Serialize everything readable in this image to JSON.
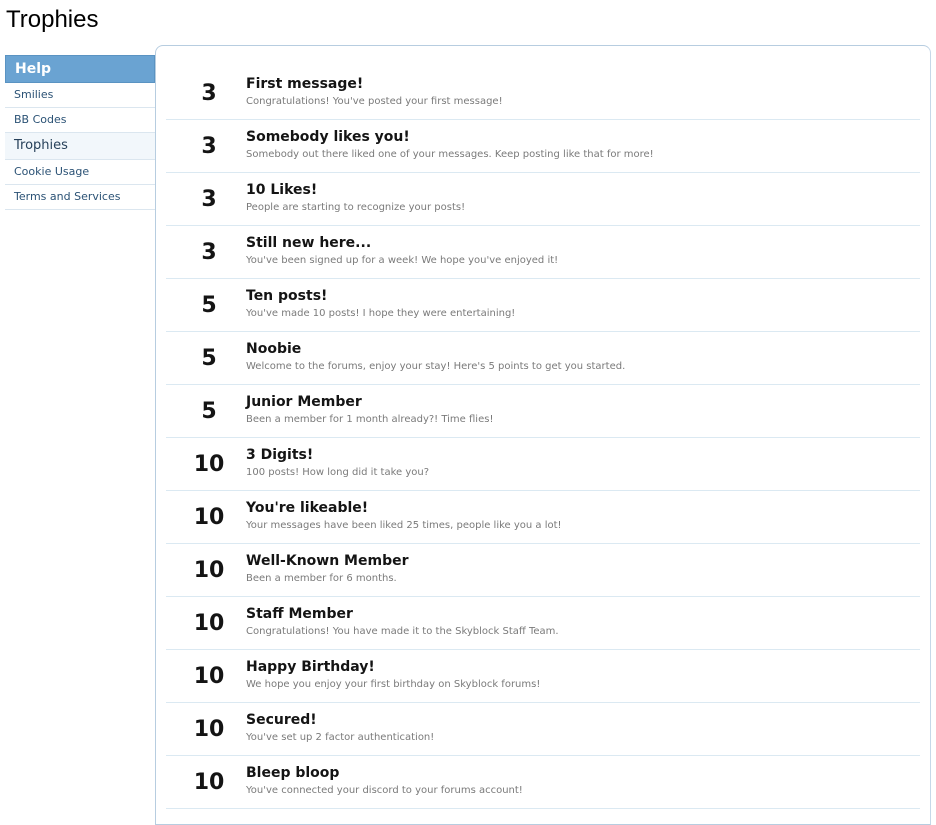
{
  "page": {
    "title": "Trophies"
  },
  "sidebar": {
    "header": "Help",
    "items": [
      {
        "label": "Smilies",
        "active": false
      },
      {
        "label": "BB Codes",
        "active": false
      },
      {
        "label": "Trophies",
        "active": true
      },
      {
        "label": "Cookie Usage",
        "active": false
      },
      {
        "label": "Terms and Services",
        "active": false
      }
    ]
  },
  "trophies": [
    {
      "points": "3",
      "title": "First message!",
      "description": "Congratulations! You've posted your first message!"
    },
    {
      "points": "3",
      "title": "Somebody likes you!",
      "description": "Somebody out there liked one of your messages. Keep posting like that for more!"
    },
    {
      "points": "3",
      "title": "10 Likes!",
      "description": "People are starting to recognize your posts!"
    },
    {
      "points": "3",
      "title": "Still new here...",
      "description": "You've been signed up for a week! We hope you've enjoyed it!"
    },
    {
      "points": "5",
      "title": "Ten posts!",
      "description": "You've made 10 posts! I hope they were entertaining!"
    },
    {
      "points": "5",
      "title": "Noobie",
      "description": "Welcome to the forums, enjoy your stay! Here's 5 points to get you started."
    },
    {
      "points": "5",
      "title": "Junior Member",
      "description": "Been a member for 1 month already?! Time flies!"
    },
    {
      "points": "10",
      "title": "3 Digits!",
      "description": "100 posts! How long did it take you?"
    },
    {
      "points": "10",
      "title": "You're likeable!",
      "description": "Your messages have been liked 25 times, people like you a lot!"
    },
    {
      "points": "10",
      "title": "Well-Known Member",
      "description": "Been a member for 6 months."
    },
    {
      "points": "10",
      "title": "Staff Member",
      "description": "Congratulations! You have made it to the Skyblock Staff Team."
    },
    {
      "points": "10",
      "title": "Happy Birthday!",
      "description": "We hope you enjoy your first birthday on Skyblock forums!"
    },
    {
      "points": "10",
      "title": "Secured!",
      "description": "You've set up 2 factor authentication!"
    },
    {
      "points": "10",
      "title": "Bleep bloop",
      "description": "You've connected your discord to your forums account!"
    }
  ]
}
